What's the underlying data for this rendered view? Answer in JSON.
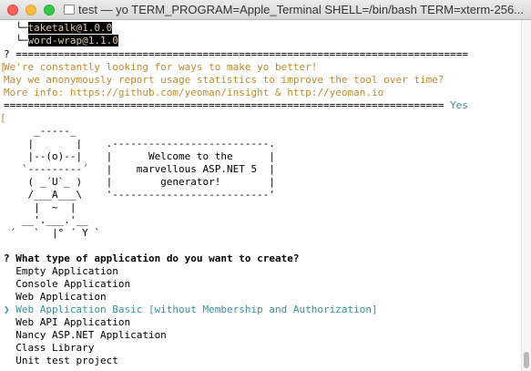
{
  "window": {
    "title": "test — yo TERM_PROGRAM=Apple_Terminal SHELL=/bin/bash TERM=xterm-256..."
  },
  "terminal": {
    "tree_branch_1": "  └─",
    "pkg_1": "taketalk@1.0.0",
    "tree_branch_2": "  └─",
    "pkg_2": "word-wrap@1.1.0",
    "sep_line_1": "? ===========================================================================",
    "insight_line_1": "We're constantly looking for ways to make yo better!",
    "insight_line_2": "May we anonymously report usage statistics to improve the tool over time?",
    "insight_line_3": "More info: https://github.com/yeoman/insight & http://yeoman.io",
    "sep_line_2": "=========================================================================",
    "answer_yes": "Yes",
    "bracket_1": "[",
    "bracket_2": "[",
    "ascii_art": [
      "     _-----_",
      "    |       |    .--------------------------.",
      "    |--(o)--|    |      Welcome to the      |",
      "   `---------´   |    marvellous ASP.NET 5  |",
      "    ( _´U`_ )    |        generator!        |",
      "    /___A___\\    '--------------------------'",
      "     |  ~  |",
      "   __'.___.'__",
      " ´   `  |° ´ Y `"
    ],
    "question_mark": "?",
    "question": "What type of application do you want to create?",
    "options": [
      "  Empty Application",
      "  Console Application",
      "  Web Application",
      "  Web API Application",
      "  Nancy ASP.NET Application",
      "  Class Library",
      "  Unit test project"
    ],
    "selected_option": "❯ Web Application Basic [without Membership and Authorization]"
  },
  "colors": {
    "insight_text": "#c08b2d",
    "accent_blue": "#3a8ea0",
    "highlight_bg": "#000000"
  }
}
